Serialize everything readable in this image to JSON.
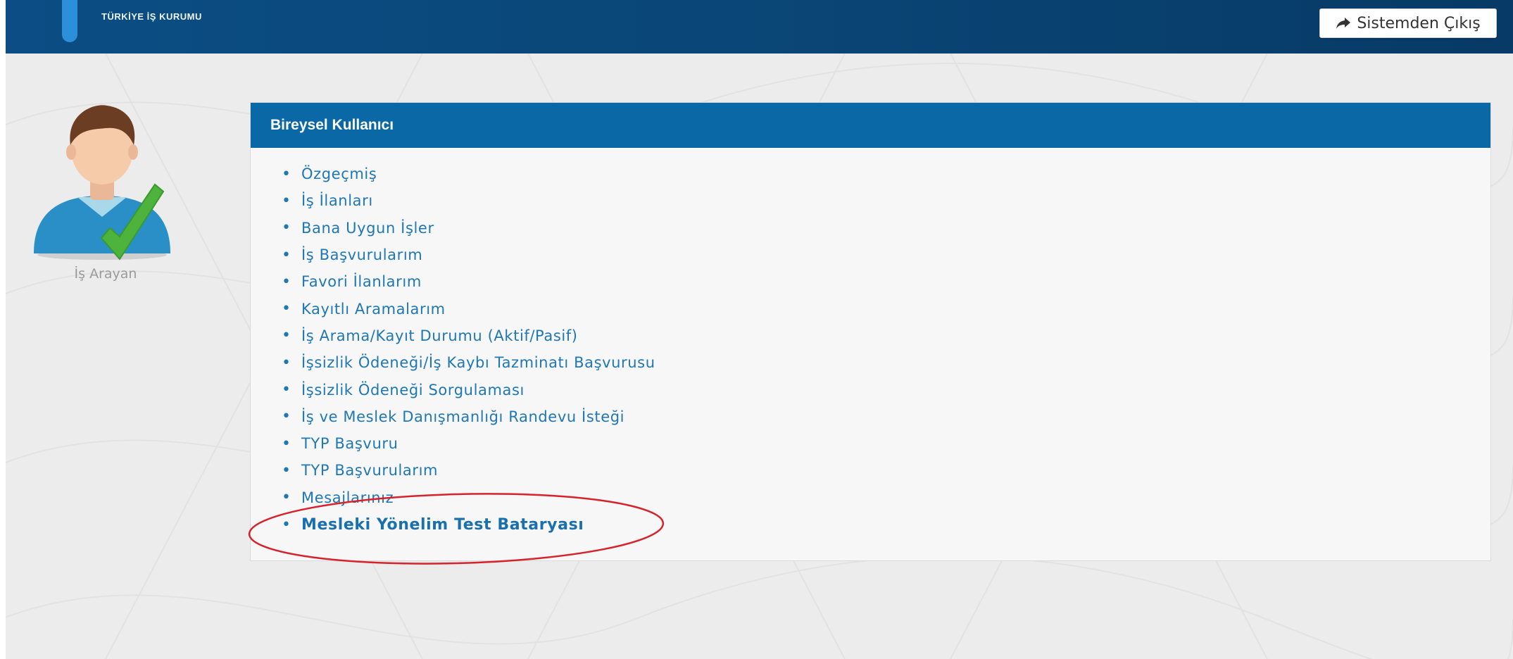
{
  "header": {
    "org_name": "TÜRKİYE İŞ KURUMU",
    "logout_label": "Sistemden Çıkış",
    "logout_icon": "share-arrow-icon"
  },
  "profile": {
    "role_label": "İş Arayan",
    "avatar_icon": "user-check-avatar-icon"
  },
  "panel": {
    "title": "Bireysel Kullanıcı",
    "items": [
      {
        "label": "Özgeçmiş"
      },
      {
        "label": "İş İlanları"
      },
      {
        "label": "Bana Uygun İşler"
      },
      {
        "label": "İş Başvurularım"
      },
      {
        "label": "Favori İlanlarım"
      },
      {
        "label": "Kayıtlı Aramalarım"
      },
      {
        "label": "İş Arama/Kayıt Durumu (Aktif/Pasif)"
      },
      {
        "label": "İşsizlik Ödeneği/İş Kaybı Tazminatı Başvurusu"
      },
      {
        "label": "İşsizlik Ödeneği Sorgulaması"
      },
      {
        "label": "İş ve Meslek Danışmanlığı Randevu İsteği"
      },
      {
        "label": "TYP Başvuru"
      },
      {
        "label": "TYP Başvurularım"
      },
      {
        "label": "Mesajlarınız"
      },
      {
        "label": "Mesleki Yönelim Test Bataryası"
      }
    ]
  },
  "colors": {
    "header_bg": "#0a4778",
    "panel_header_bg": "#0a68a7",
    "link": "#1f77b5",
    "highlight_ellipse": "#d8222b"
  }
}
